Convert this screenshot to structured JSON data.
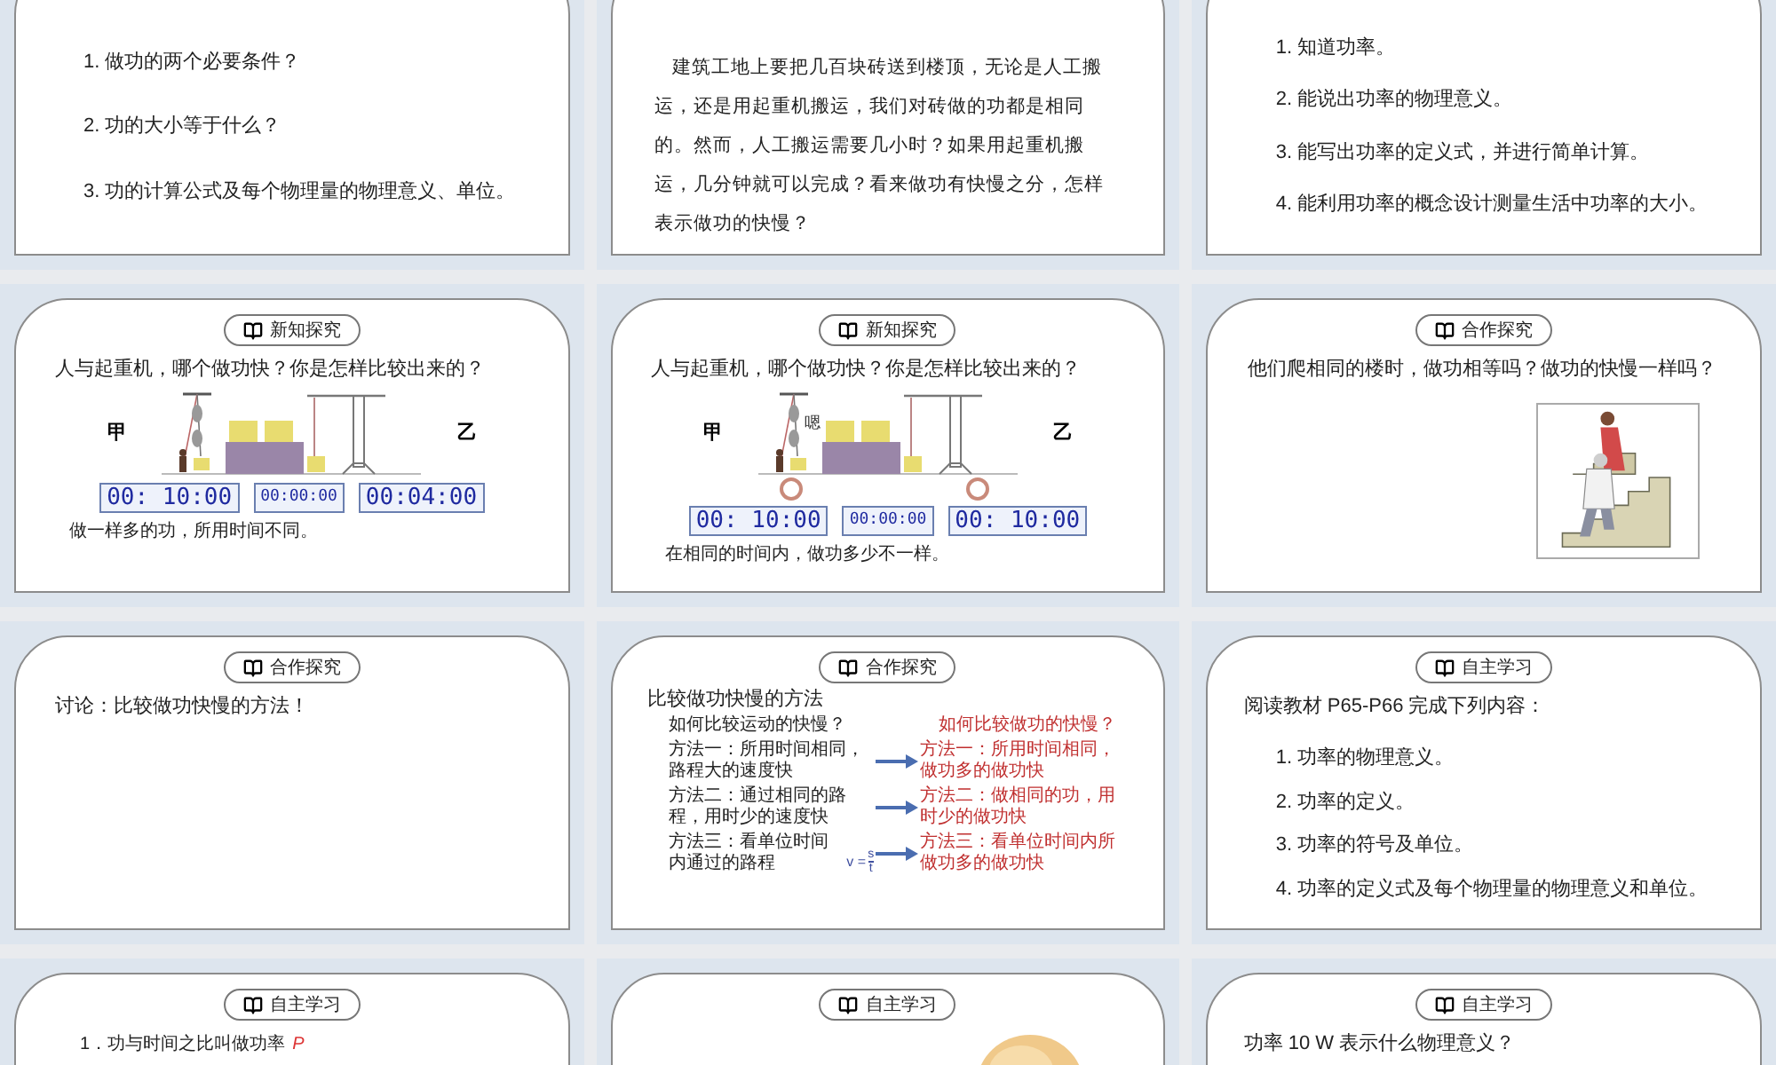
{
  "slides": [
    {
      "blocks": [
        {
          "kind": "numbered_list",
          "items": [
            "1. 做功的两个必要条件？",
            "2. 功的大小等于什么？",
            "3. 功的计算公式及每个物理量的物理意义、单位。"
          ]
        }
      ]
    },
    {
      "blocks": [
        {
          "kind": "paragraph",
          "text": "建筑工地上要把几百块砖送到楼顶，无论是人工搬运，还是用起重机搬运，我们对砖做的功都是相同的。然而，人工搬运需要几小时？如果用起重机搬运，几分钟就可以完成？看来做功有快慢之分，怎样表示做功的快慢？"
        }
      ]
    },
    {
      "blocks": [
        {
          "kind": "numbered_list",
          "items": [
            "1. 知道功率。",
            "2. 能说出功率的物理意义。",
            "3. 能写出功率的定义式，并进行简单计算。",
            "4. 能利用功率的概念设计测量生活中功率的大小。"
          ]
        }
      ]
    },
    {
      "badge": "新知探究",
      "blocks": [
        {
          "kind": "question",
          "text": "人与起重机，哪个做功快？你是怎样比较出来的？"
        },
        {
          "kind": "scene",
          "left_label": "甲",
          "right_label": "乙",
          "clocks": false,
          "timers": [
            "00: 10:00",
            "00:00:00",
            "00:04:00"
          ]
        },
        {
          "kind": "caption",
          "text": "做一样多的功，所用时间不同。"
        }
      ]
    },
    {
      "badge": "新知探究",
      "blocks": [
        {
          "kind": "question",
          "text": "人与起重机，哪个做功快？你是怎样比较出来的？"
        },
        {
          "kind": "scene",
          "left_label": "甲",
          "shout": "嗯",
          "right_label": "乙",
          "clocks": true,
          "timers": [
            "00: 10:00",
            "00:00:00",
            "00: 10:00"
          ]
        },
        {
          "kind": "caption",
          "text": "在相同的时间内，做功多少不一样。"
        }
      ]
    },
    {
      "badge": "合作探究",
      "blocks": [
        {
          "kind": "question",
          "text": "他们爬相同的楼时，做功相等吗？做功的快慢一样吗？"
        },
        {
          "kind": "picture"
        }
      ]
    },
    {
      "badge": "合作探究",
      "blocks": [
        {
          "kind": "question",
          "text": "讨论：比较做功快慢的方法！"
        }
      ]
    },
    {
      "badge": "合作探究",
      "blocks": [
        {
          "kind": "comparison",
          "heading": "比较做功快慢的方法",
          "left_title": "如何比较运动的快慢？",
          "right_title": "如何比较做功的快慢？",
          "rows": [
            {
              "left": "方法一：所用时间相同，路程大的速度快",
              "right": "方法一：所用时间相同，做功多的做功快"
            },
            {
              "left": "方法二：通过相同的路程，用时少的速度快",
              "right": "方法二：做相同的功，用时少的做功快"
            },
            {
              "left": "方法三：看单位时间内通过的路程",
              "formula": {
                "lhs": "v =",
                "numerator": "s",
                "denominator": "t"
              },
              "right": "方法三：看单位时间内所做功多的做功快"
            }
          ]
        }
      ]
    },
    {
      "badge": "自主学习",
      "blocks": [
        {
          "kind": "intro",
          "text": "阅读教材 P65-P66 完成下列内容："
        },
        {
          "kind": "numbered_list",
          "items": [
            "1. 功率的物理意义。",
            "2. 功率的定义。",
            "3. 功率的符号及单位。",
            "4. 功率的定义式及每个物理量的物理意义和单位。"
          ]
        }
      ]
    },
    {
      "badge": "自主学习",
      "blocks": [
        {
          "kind": "definition",
          "text": "1．功与时间之比叫做功率",
          "symbol": "P"
        }
      ]
    },
    {
      "badge": "自主学习",
      "blocks": [
        {
          "kind": "portrait"
        }
      ]
    },
    {
      "badge": "自主学习",
      "blocks": [
        {
          "kind": "intro",
          "text": "功率 10 W 表示什么物理意义？"
        }
      ]
    }
  ]
}
